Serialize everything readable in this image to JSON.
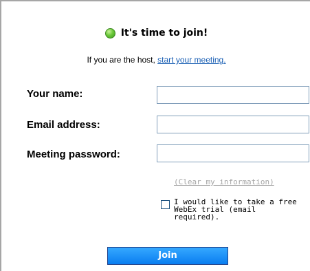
{
  "header": {
    "status_icon": "green-dot-icon",
    "status_color": "#6cc93a",
    "title": "It's time to join!"
  },
  "host": {
    "prefix": "If you are the host, ",
    "link": "start your meeting."
  },
  "form": {
    "name_label": "Your name:",
    "name_value": "",
    "email_label": "Email address:",
    "email_value": "",
    "password_label": "Meeting password:",
    "password_value": "",
    "clear_link": "(Clear my information)",
    "trial_label": "I would like to take a free\nWebEx trial (email\nrequired).",
    "trial_checked": false
  },
  "actions": {
    "join_label": "Join",
    "join_color": "#1a8cff"
  }
}
